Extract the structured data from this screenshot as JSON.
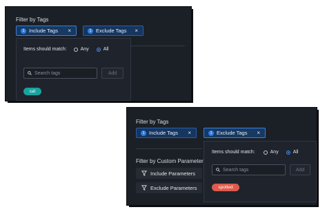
{
  "panel_a": {
    "title": "Filter by Tags",
    "chips": [
      {
        "num": "1",
        "label": "Include Tags",
        "close": "×"
      },
      {
        "num": "1",
        "label": "Exclude Tags",
        "close": "×"
      }
    ],
    "dropdown": {
      "match_label": "Items should match:",
      "option_any": "Any",
      "option_all": "All",
      "selected": "All",
      "search_placeholder": "Search tags",
      "add_label": "Add",
      "tag": {
        "label": "cat",
        "color": "#19a3a0"
      }
    }
  },
  "panel_b": {
    "title": "Filter by Tags",
    "chips": [
      {
        "num": "1",
        "label": "Include Tags",
        "close": "×"
      },
      {
        "num": "1",
        "label": "Exclude Tags",
        "close": "×"
      }
    ],
    "params_title": "Filter by Custom Parameters",
    "params_buttons": [
      {
        "label": "Include Parameters",
        "icon": "filter-icon"
      },
      {
        "label": "Exclude Parameters",
        "icon": "filter-icon"
      }
    ],
    "dropdown": {
      "match_label": "Items should match:",
      "option_any": "Any",
      "option_all": "All",
      "selected": "All",
      "search_placeholder": "Search tags",
      "add_label": "Add",
      "tag": {
        "label": "spotted",
        "color": "#e05a4e"
      }
    }
  }
}
